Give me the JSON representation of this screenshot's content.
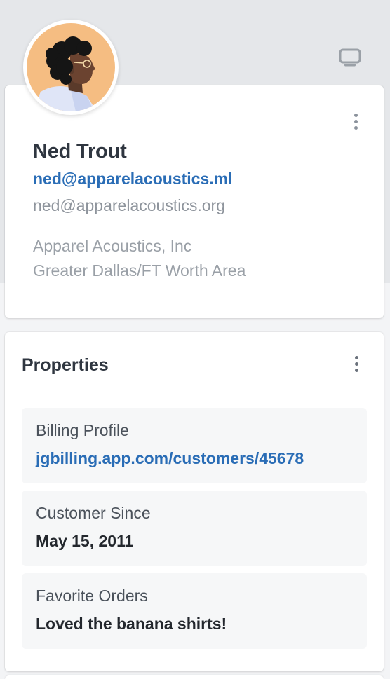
{
  "contact": {
    "name": "Ned Trout",
    "email_primary": "ned@apparelacoustics.ml",
    "email_secondary": "ned@apparelacoustics.org",
    "company": "Apparel Acoustics, Inc",
    "location": "Greater Dallas/FT Worth Area"
  },
  "properties": {
    "title": "Properties",
    "items": [
      {
        "label": "Billing Profile",
        "value": "jgbilling.app.com/customers/45678"
      },
      {
        "label": "Customer Since",
        "value": "May 15, 2011"
      },
      {
        "label": "Favorite Orders",
        "value": "Loved the banana shirts!"
      }
    ]
  },
  "icons": {
    "top_right": "monitor-icon",
    "menu": "more-vertical-icon"
  },
  "colors": {
    "link": "#2a6db6",
    "avatar_bg": "#f5bd82",
    "header_bg": "#e5e7ea"
  }
}
